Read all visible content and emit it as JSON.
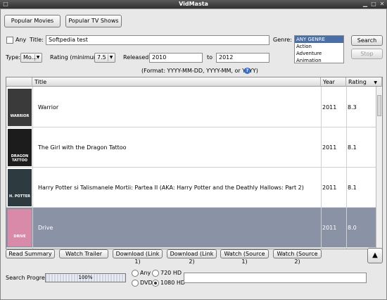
{
  "window": {
    "title": "VidMasta"
  },
  "top_tabs": {
    "popular_movies": "Popular Movies",
    "popular_tv": "Popular TV Shows"
  },
  "search": {
    "any_label": "Any",
    "title_label": "Title:",
    "title_value": "Softpedia test",
    "genre_label": "Genre:",
    "genres": [
      "ANY GENRE",
      "Action",
      "Adventure",
      "Animation"
    ],
    "search_button": "Search",
    "stop_button": "Stop",
    "type_label": "Type:",
    "type_value": "Mo...",
    "rating_label": "Rating (minimum):",
    "rating_value": "7.5",
    "released_label": "Released:",
    "released_from": "2010",
    "to_label": "to",
    "released_to": "2012",
    "format_hint": "(Format: YYYY-MM-DD, YYYY-MM, or YYYY)",
    "help_icon": "?"
  },
  "table": {
    "headers": {
      "title": "Title",
      "year": "Year",
      "rating": "Rating"
    },
    "sort_indicator": "▼",
    "rows": [
      {
        "title": "Warrior",
        "year": "2011",
        "rating": "8.3",
        "poster_text": "WARRIOR",
        "poster_color": "#3a3a3a",
        "selected": false
      },
      {
        "title": "The Girl with the Dragon Tattoo",
        "year": "2011",
        "rating": "8.1",
        "poster_text": "DRAGON TATTOO",
        "poster_color": "#1c1c1c",
        "selected": false
      },
      {
        "title": "Harry Potter si Talismanele Mortii: Partea II (AKA: Harry Potter and the Deathly Hallows: Part 2)",
        "year": "2011",
        "rating": "8.1",
        "poster_text": "H. POTTER",
        "poster_color": "#2d3a40",
        "selected": false
      },
      {
        "title": "Drive",
        "year": "2011",
        "rating": "8.0",
        "poster_text": "DRIVE",
        "poster_color": "#d98aa8",
        "selected": true
      }
    ]
  },
  "actions": {
    "read_summary": "Read Summary",
    "watch_trailer": "Watch Trailer",
    "download_1": "Download (Link 1)",
    "download_2": "Download (Link 2)",
    "watch_source_1": "Watch (Source 1)",
    "watch_source_2": "Watch (Source 2)",
    "scroll_up": "▲"
  },
  "bottom": {
    "progress_label": "Search Progress:",
    "progress_value": "100%",
    "progress_fraction": 1.0,
    "opt_any": "Any",
    "opt_720": "720 HD",
    "opt_dvd": "DVD",
    "opt_1080": "1080 HD",
    "selected_quality": "1080 HD"
  }
}
